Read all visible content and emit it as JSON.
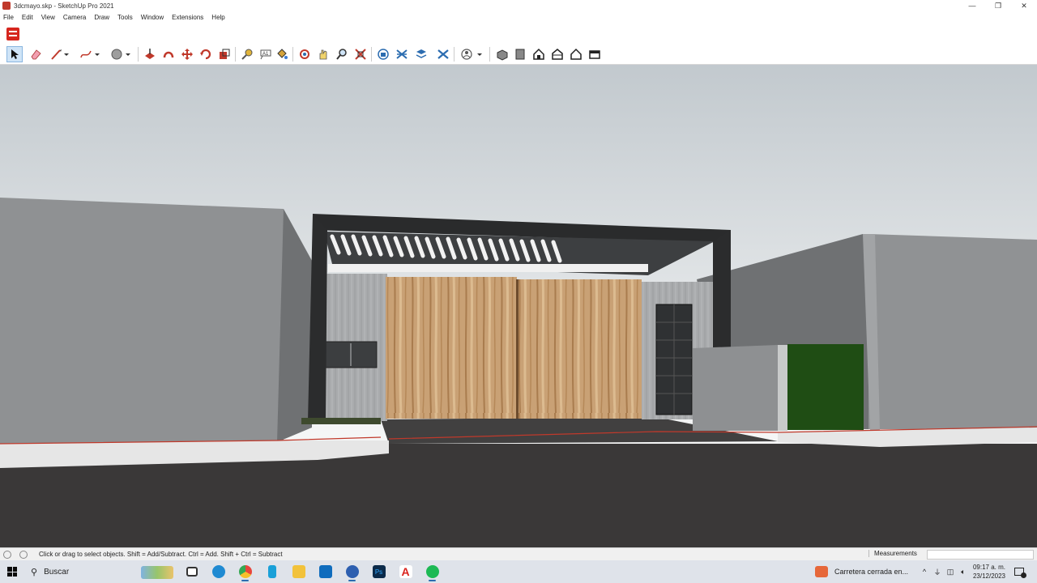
{
  "window": {
    "title": "3dcmayo.skp - SketchUp Pro 2021",
    "controls": {
      "minimize": "—",
      "restore": "❐",
      "close": "✕"
    }
  },
  "menu": {
    "items": [
      "File",
      "Edit",
      "View",
      "Camera",
      "Draw",
      "Tools",
      "Window",
      "Extensions",
      "Help"
    ]
  },
  "large_toolset": {
    "icon": "large-tool-set-icon"
  },
  "toolbar": {
    "tools": [
      {
        "name": "select",
        "icon": "select-arrow-icon",
        "selected": true
      },
      {
        "name": "eraser",
        "icon": "eraser-icon"
      },
      {
        "name": "line",
        "icon": "pencil-line-icon"
      },
      {
        "name": "freehand",
        "icon": "freehand-icon"
      },
      {
        "name": "circle",
        "icon": "circle-icon"
      },
      {
        "name": "push-pull",
        "icon": "push-pull-icon"
      },
      {
        "name": "follow-me",
        "icon": "follow-me-icon"
      },
      {
        "name": "move",
        "icon": "move-icon"
      },
      {
        "name": "rotate",
        "icon": "rotate-icon"
      },
      {
        "name": "scale",
        "icon": "scale-icon"
      },
      {
        "name": "tape-measure",
        "icon": "tape-measure-icon"
      },
      {
        "name": "text",
        "icon": "text-icon"
      },
      {
        "name": "paint-bucket",
        "icon": "paint-bucket-icon"
      },
      {
        "name": "orbit",
        "icon": "orbit-icon"
      },
      {
        "name": "pan",
        "icon": "pan-icon"
      },
      {
        "name": "zoom",
        "icon": "zoom-icon"
      },
      {
        "name": "zoom-extents",
        "icon": "zoom-extents-icon"
      },
      {
        "name": "3d-warehouse",
        "icon": "warehouse-icon"
      },
      {
        "name": "extension-warehouse",
        "icon": "extension-warehouse-icon"
      },
      {
        "name": "layout",
        "icon": "layout-icon"
      },
      {
        "name": "extension-manager",
        "icon": "extension-manager-icon"
      },
      {
        "name": "styles",
        "icon": "styles-icon"
      },
      {
        "name": "iso-view",
        "icon": "iso-view-icon"
      },
      {
        "name": "top-view",
        "icon": "top-view-icon"
      },
      {
        "name": "front-view",
        "icon": "front-view-icon"
      },
      {
        "name": "right-view",
        "icon": "right-view-icon"
      },
      {
        "name": "back-view",
        "icon": "back-view-icon"
      },
      {
        "name": "left-view",
        "icon": "left-view-icon"
      }
    ]
  },
  "status": {
    "hint": "Click or drag to select objects. Shift = Add/Subtract. Ctrl = Add. Shift + Ctrl = Subtract",
    "measurements_label": "Measurements",
    "measurements_value": ""
  },
  "taskbar": {
    "search_placeholder": "Buscar",
    "news": "Carretera cerrada en...",
    "time": "09:17 a. m.",
    "date": "23/12/2023",
    "apps": [
      {
        "name": "task-view",
        "color": "#3a3a3a"
      },
      {
        "name": "edge",
        "color": "#1f8ad2"
      },
      {
        "name": "chrome",
        "color": "#e8453c"
      },
      {
        "name": "app-blue",
        "color": "#1aa0d8"
      },
      {
        "name": "file-explorer",
        "color": "#f2c23b"
      },
      {
        "name": "mail",
        "color": "#0f6cbd"
      },
      {
        "name": "sketchup",
        "color": "#2d5fb0"
      },
      {
        "name": "photoshop",
        "color": "#0b2a4a"
      },
      {
        "name": "acrobat",
        "color": "#d9221c"
      },
      {
        "name": "spotify",
        "color": "#1db954"
      }
    ]
  }
}
